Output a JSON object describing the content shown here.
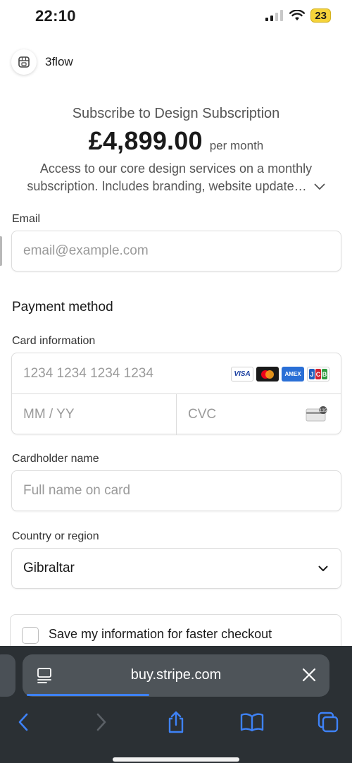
{
  "status_bar": {
    "time": "22:10",
    "battery": "23",
    "signal_icon": "cellular-signal-icon",
    "wifi_icon": "wifi-icon"
  },
  "merchant": {
    "name": "3flow",
    "logo_icon": "storefront-icon"
  },
  "summary": {
    "title": "Subscribe to Design Subscription",
    "price": "£4,899.00",
    "period": "per month",
    "description_line1": "Access to our core design services on a monthly",
    "description_line2": "subscription. Includes branding, website update…",
    "expand_icon": "chevron-down-icon"
  },
  "form": {
    "email_label": "Email",
    "email_placeholder": "email@example.com",
    "payment_method_title": "Payment method",
    "card_info_label": "Card information",
    "card_number_placeholder": "1234 1234 1234 1234",
    "card_brands": [
      "VISA",
      "Mastercard",
      "AMEX",
      "JCB"
    ],
    "expiry_placeholder": "MM / YY",
    "cvc_placeholder": "CVC",
    "cvc_icon_text": "135",
    "cardholder_label": "Cardholder name",
    "cardholder_placeholder": "Full name on card",
    "country_label": "Country or region",
    "country_value": "Gibraltar",
    "save_info_label": "Save my information for faster checkout"
  },
  "browser": {
    "url": "buy.stripe.com",
    "load_progress": 0.4,
    "reader_icon": "reader-mode-icon",
    "close_icon": "close-icon",
    "nav_icons": [
      "back-icon",
      "forward-icon",
      "share-icon",
      "bookmarks-icon",
      "tabs-icon"
    ]
  },
  "colors": {
    "accent_blue": "#3e82f7",
    "chrome_bg": "#2b3034",
    "battery": "#f5d33a"
  }
}
